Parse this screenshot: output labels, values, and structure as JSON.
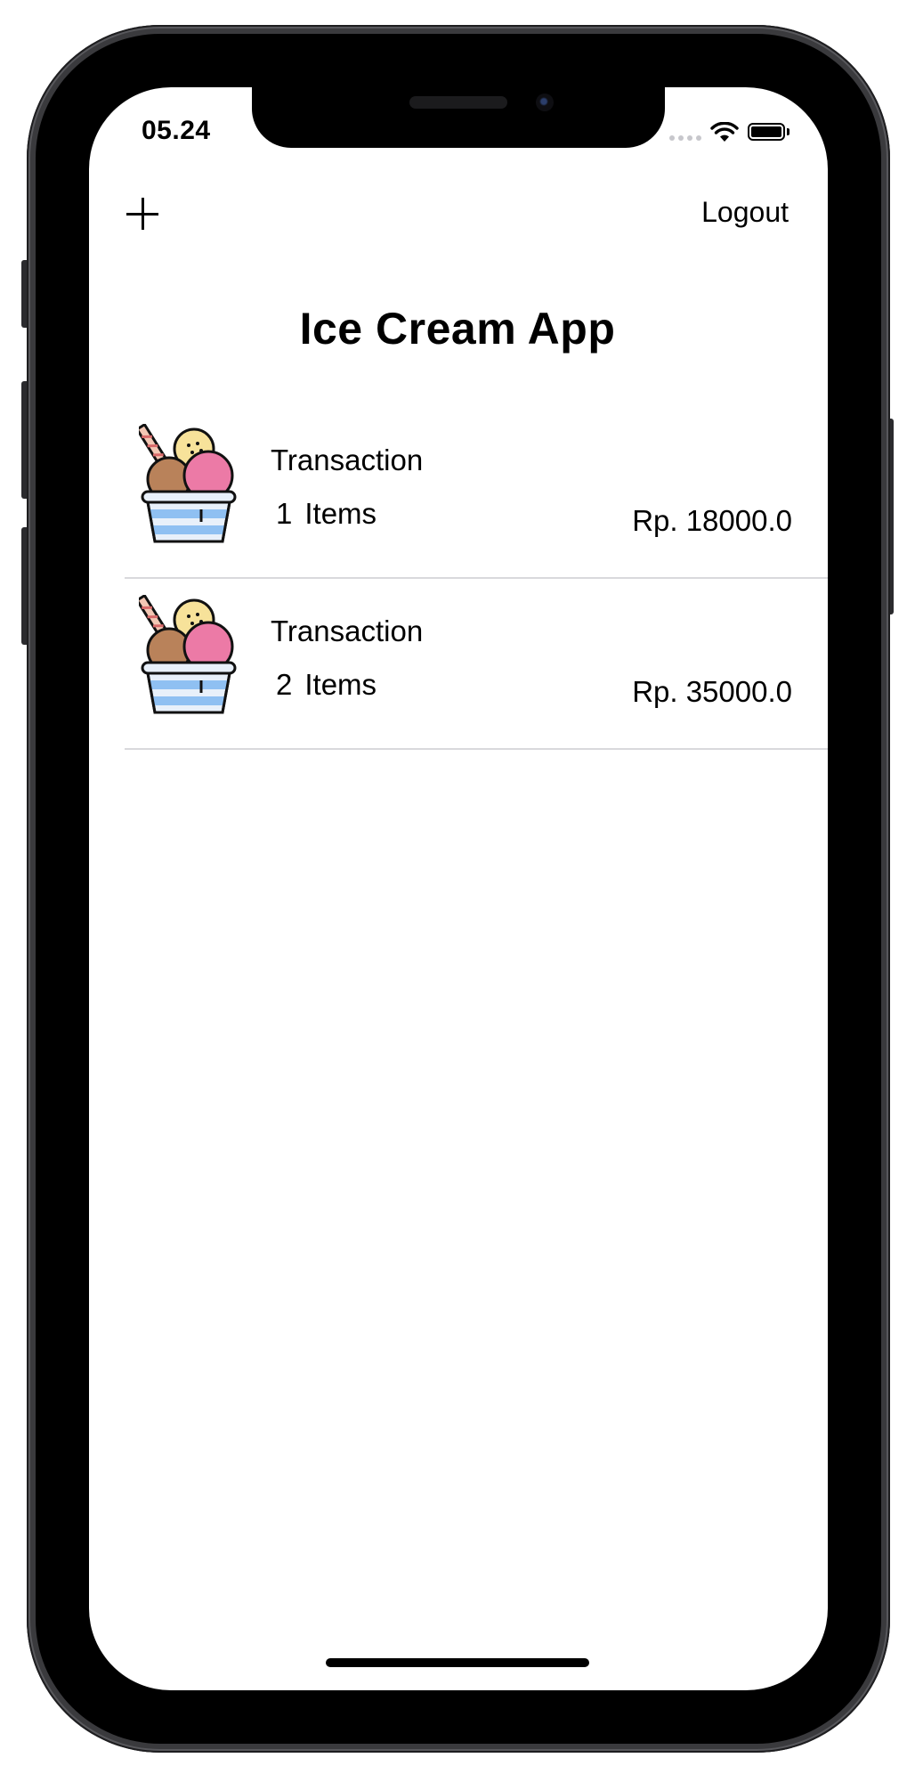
{
  "status_bar": {
    "time": "05.24",
    "wifi_icon": "wifi-icon",
    "battery_icon": "battery-icon"
  },
  "nav": {
    "add_icon": "plus-icon",
    "logout_label": "Logout"
  },
  "title": "Ice Cream App",
  "transactions": [
    {
      "icon": "ice-cream-cup-icon",
      "title": "Transaction",
      "count": "1",
      "count_label": "Items",
      "price": "Rp. 18000.0"
    },
    {
      "icon": "ice-cream-cup-icon",
      "title": "Transaction",
      "count": "2",
      "count_label": "Items",
      "price": "Rp. 35000.0"
    }
  ],
  "colors": {
    "background": "#ffffff",
    "text": "#000000",
    "divider": "#d9d9dc",
    "scoop_vanilla": "#f7e29a",
    "scoop_chocolate": "#b9825a",
    "scoop_strawberry": "#ec7aa6",
    "cup_blue": "#8fc0f2"
  }
}
